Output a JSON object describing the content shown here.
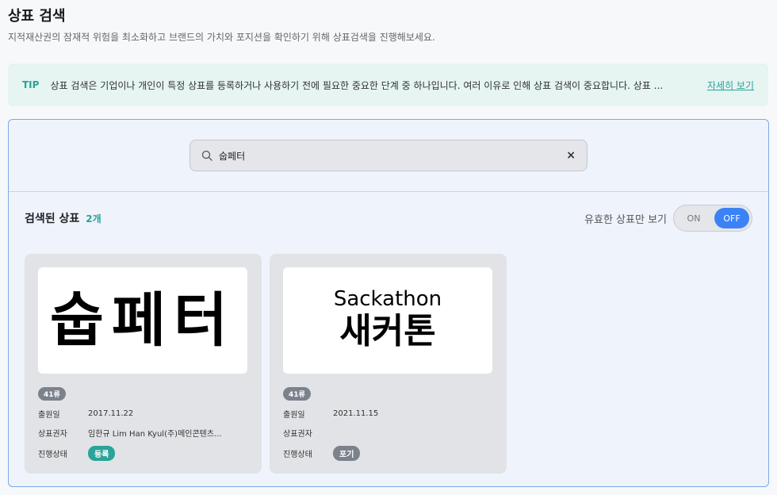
{
  "header": {
    "title": "상표 검색",
    "subtitle": "지적재산권의 잠재적 위험을 최소화하고 브랜드의 가치와 포지션을 확인하기 위해 상표검색을 진행해보세요."
  },
  "tip": {
    "label": "TIP",
    "text": "상표 검색은 기업이나 개인이 특정 상표를 등록하거나 사용하기 전에 필요한 중요한 단계 중 하나입니다. 여러 이유로 인해 상표 검색이 중요합니다. 상표 ...",
    "link": "자세히 보기"
  },
  "search": {
    "value": "숩페터",
    "clear": "×"
  },
  "results": {
    "title": "검색된 상표",
    "count": "2개",
    "valid_only_label": "유효한 상표만 보기",
    "toggle_on": "ON",
    "toggle_off": "OFF"
  },
  "labels": {
    "filing_date": "출원일",
    "owner": "상표권자",
    "status": "진행상태"
  },
  "cards": [
    {
      "mark_text": "숩페터",
      "class": "41류",
      "filing_date": "2017.11.22",
      "owner": "임한규 Lim Han Kyul(주)메인콘텐츠...",
      "status": "등록"
    },
    {
      "mark_en": "Sackathon",
      "mark_ko": "새커톤",
      "class": "41류",
      "filing_date": "2021.11.15",
      "owner": "",
      "status": "포기"
    }
  ],
  "colors": {
    "accent": "#2aa39a",
    "toggle_active": "#3b82f6",
    "panel_border": "#7fa8e6"
  },
  "icons": {
    "search": "search-icon",
    "clear": "close-icon"
  }
}
